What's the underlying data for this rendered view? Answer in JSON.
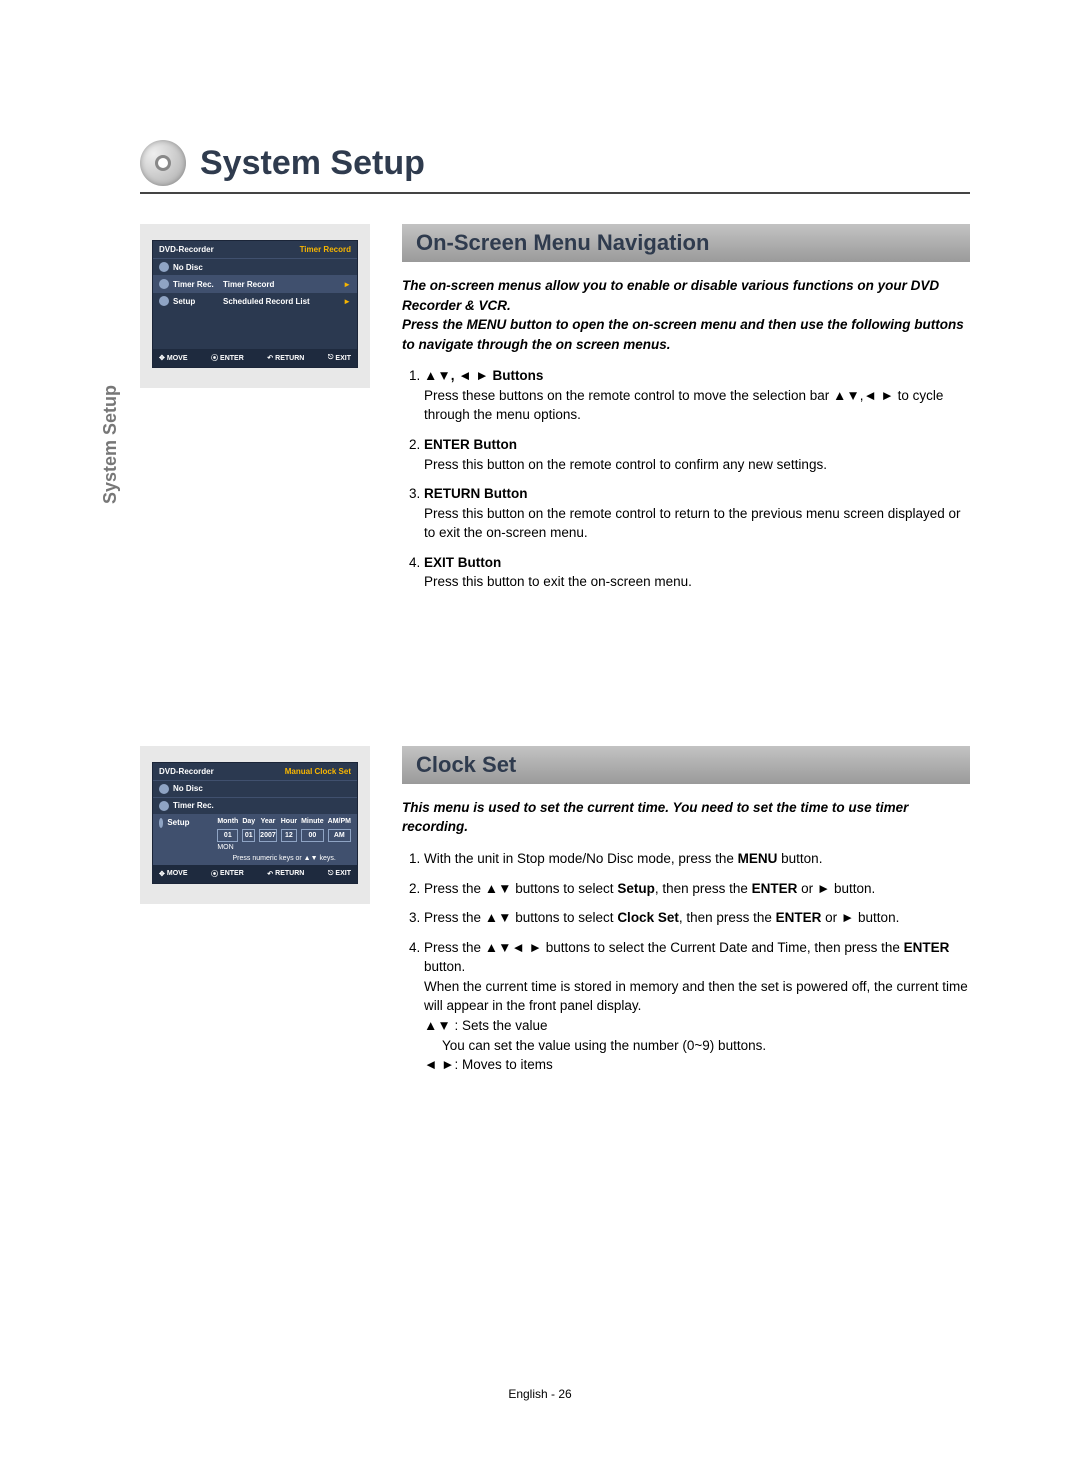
{
  "chapter_title": "System Setup",
  "side_tab": "System Setup",
  "footer": "English - 26",
  "osd1": {
    "header_left": "DVD-Recorder",
    "header_right": "Timer Record",
    "rows": [
      {
        "icon": "disc",
        "label": "No Disc",
        "value": ""
      },
      {
        "icon": "timer",
        "label": "Timer Rec.",
        "value": "Timer Record",
        "arrow": true,
        "sel": true
      },
      {
        "icon": "gear",
        "label": "Setup",
        "value": "Scheduled Record List",
        "arrow": true
      }
    ],
    "foot": [
      "MOVE",
      "ENTER",
      "RETURN",
      "EXIT"
    ]
  },
  "osd2": {
    "header_left": "DVD-Recorder",
    "header_right": "Manual Clock Set",
    "rows": [
      {
        "icon": "disc",
        "label": "No Disc"
      },
      {
        "icon": "timer",
        "label": "Timer Rec."
      },
      {
        "icon": "gear",
        "label": "Setup",
        "sel": true
      }
    ],
    "headers": [
      "Month",
      "Day",
      "Year",
      "Hour",
      "Minute",
      "AM/PM"
    ],
    "cells": [
      "01",
      "01",
      "2007",
      "12",
      "00",
      "AM"
    ],
    "dayname": "MON",
    "hint": "Press numeric keys or ▲▼ keys.",
    "foot": [
      "MOVE",
      "ENTER",
      "RETURN",
      "EXIT"
    ]
  },
  "sec1": {
    "title": "On-Screen Menu Navigation",
    "intro": "The on-screen menus allow you to enable or disable various functions on your DVD Recorder & VCR.\nPress the MENU button to open the on-screen menu and then use the following buttons to navigate through the on screen menus.",
    "steps": [
      {
        "label": "▲▼, ◄ ► Buttons",
        "text": "Press these buttons on the remote control to move the selection bar ▲▼,◄ ► to cycle through the menu options."
      },
      {
        "label": "ENTER Button",
        "text": "Press this button on the remote control to confirm any new settings."
      },
      {
        "label": "RETURN Button",
        "text": "Press this button on the remote control to return to the previous menu screen displayed or to exit the on-screen menu."
      },
      {
        "label": "EXIT Button",
        "text": "Press this button to exit the on-screen menu."
      }
    ]
  },
  "sec2": {
    "title": "Clock Set",
    "intro": "This menu is used to set the current time. You need to set the time to use timer recording.",
    "steps": [
      {
        "pre": "With the unit in Stop mode/No Disc mode, press the ",
        "b1": "MENU",
        "post": " button."
      },
      {
        "pre": "Press the ▲▼ buttons to select ",
        "b1": "Setup",
        "mid": ", then press the ",
        "b2": "ENTER",
        "post": " or ► button."
      },
      {
        "pre": "Press the ▲▼ buttons to select ",
        "b1": "Clock Set",
        "mid": ", then press the ",
        "b2": "ENTER",
        "post": " or ► button."
      },
      {
        "pre": "Press the ▲▼◄ ► buttons to select the Current Date and Time, then press the ",
        "b1": "ENTER",
        "post": " button.",
        "extra": "When the current time is stored in memory and then the set is powered off, the current time will appear in the front panel display.",
        "s1": "▲▼ : Sets the value",
        "s1b": "You can set the value using the number (0~9) buttons.",
        "s2": "◄ ►: Moves to items"
      }
    ]
  }
}
